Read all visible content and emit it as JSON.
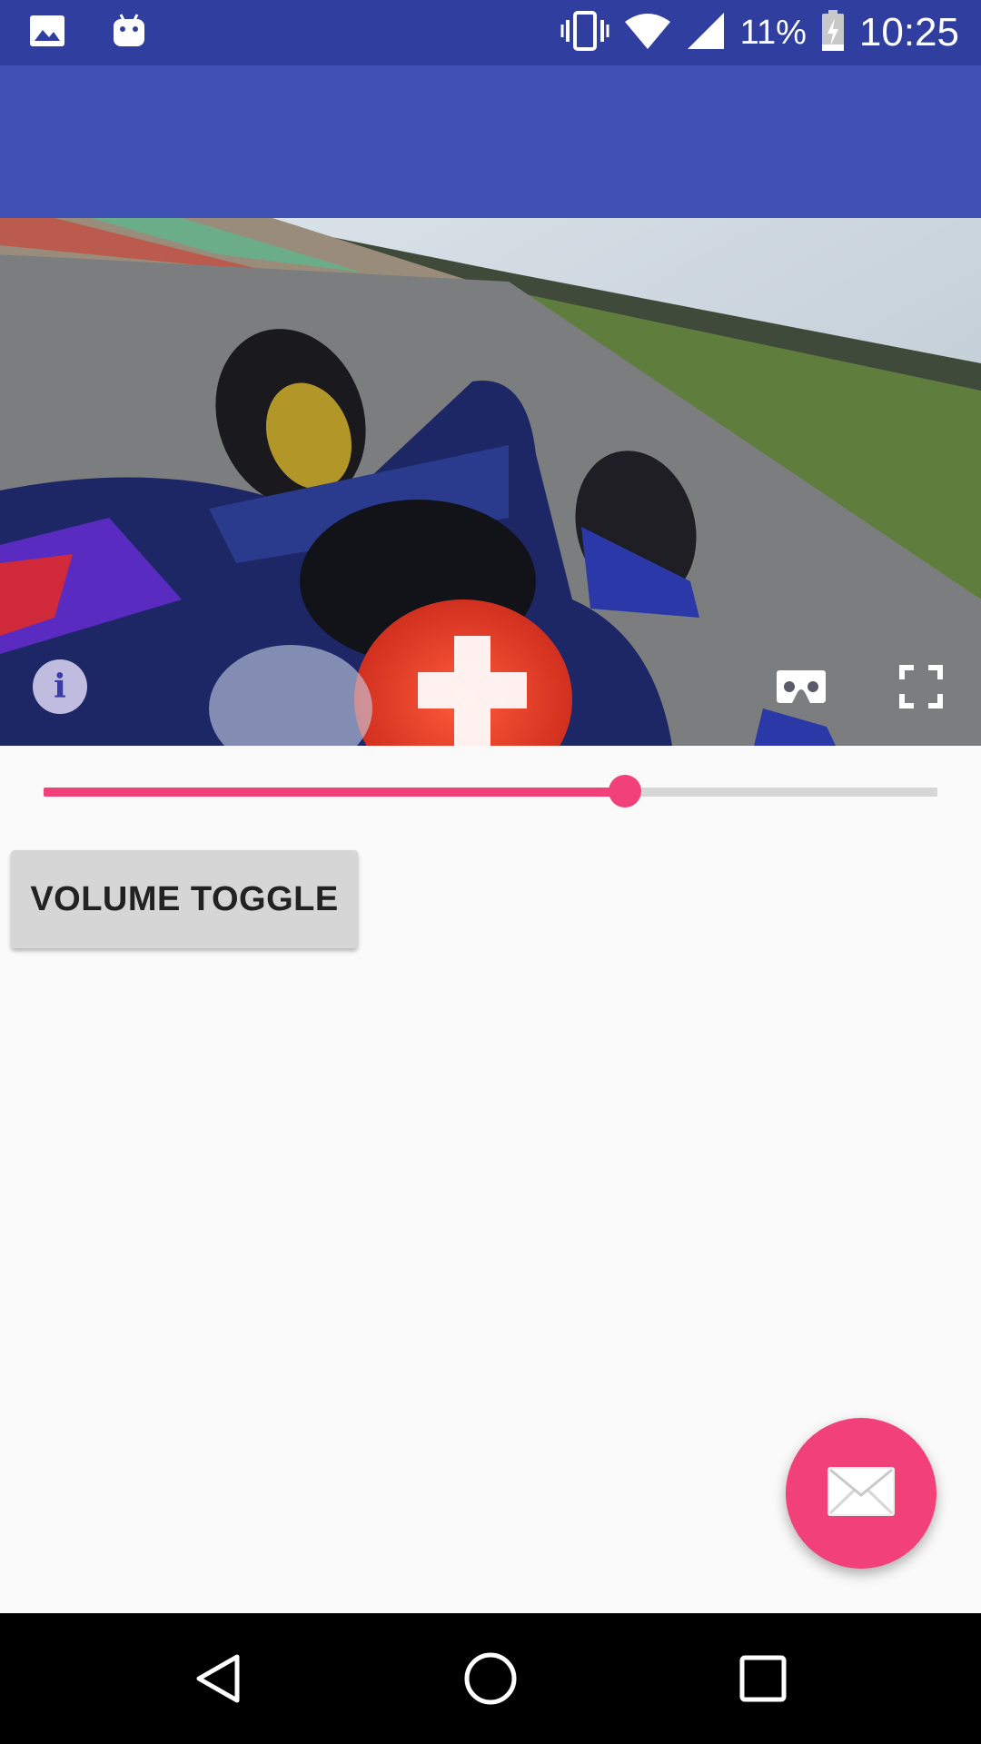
{
  "status_bar": {
    "time": "10:25",
    "battery_percent": "11%",
    "icons": [
      "image-icon",
      "android-icon",
      "vibrate-icon",
      "wifi-icon",
      "signal-icon",
      "battery-charging-icon"
    ]
  },
  "app_bar": {
    "title": ""
  },
  "video": {
    "icons": [
      "info-icon",
      "cardboard-vr-icon",
      "fullscreen-icon"
    ]
  },
  "seekbar": {
    "progress_fraction": 0.65,
    "accent_color": "#f2417a"
  },
  "volume_button": {
    "label": "VOLUME TOGGLE"
  },
  "fab": {
    "icon": "email-icon",
    "color": "#f2417a"
  },
  "nav_bar": {
    "icons": [
      "back-icon",
      "home-icon",
      "recents-icon"
    ]
  },
  "colors": {
    "status_bar": "#303f9f",
    "app_bar": "#3f51b5",
    "background": "#fafafa"
  }
}
